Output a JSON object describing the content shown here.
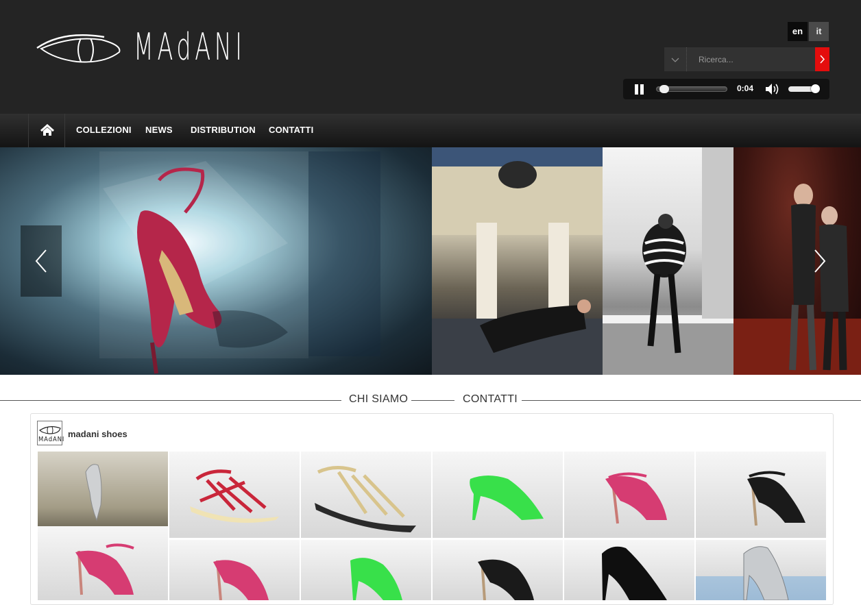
{
  "brand": {
    "name": "MAdANI"
  },
  "header": {
    "languages": [
      "en",
      "it"
    ],
    "search": {
      "placeholder": "Ricerca..."
    },
    "player": {
      "time": "0:04",
      "progress_pct": 5,
      "volume_pct": 85
    }
  },
  "nav": {
    "items": [
      "COLLEZIONI",
      "NEWS",
      "DISTRIBUTION",
      "CONTATTI"
    ]
  },
  "sections": {
    "links": [
      "CHI SIAMO",
      "CONTATTI"
    ]
  },
  "profile": {
    "name": "madani shoes",
    "avatar_text": "MAdANI"
  },
  "colors": {
    "header_bg": "#242424",
    "accent": "#e40d0d",
    "text": "#333333"
  }
}
